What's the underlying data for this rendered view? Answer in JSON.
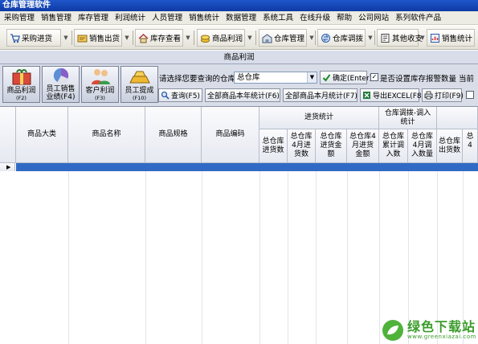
{
  "window": {
    "title": "仓库管理软件"
  },
  "menu": [
    "采购管理",
    "销售管理",
    "库存管理",
    "利润统计",
    "人员管理",
    "销售统计",
    "数据管理",
    "系统工具",
    "在线升级",
    "帮助",
    "公司网站",
    "系列软件产品"
  ],
  "toolbar": {
    "purchase": "采购进货",
    "sales": "销售出货",
    "stock": "库存查看",
    "profit": "商品利润",
    "warehouse": "仓库管理",
    "transfer": "仓库调拨",
    "other": "其他收支",
    "stats": "销售统计"
  },
  "section_title": "商品利润",
  "big_buttons": [
    {
      "label": "商品利润",
      "key": "(F2)"
    },
    {
      "label1": "员工销售",
      "label2": "业绩(F4)"
    },
    {
      "label": "客户利润",
      "key": "(F3)"
    },
    {
      "label": "员工提成",
      "key": "(F10)"
    }
  ],
  "filter": {
    "prompt": "请选择您要查询的仓库",
    "warehouse": "总仓库",
    "confirm": "确定(Enter)",
    "alarm_check": "是否设置库存报警数量",
    "alarm_checked": "✓",
    "current": "当前"
  },
  "actions": {
    "query": "查询(F5)",
    "year": "全部商品本年统计(F6)",
    "month": "全部商品本月统计(F7)",
    "excel": "导出EXCEL(F8)",
    "print": "打印(F9)"
  },
  "grid": {
    "cols": {
      "category": "商品大类",
      "name": "商品名称",
      "spec": "商品规格",
      "code": "商品编码"
    },
    "group_purchase": "进货统计",
    "group_transfer1": "仓库调拨-调入",
    "group_transfer2": "统计",
    "sub": [
      {
        "a": "总仓库",
        "b": "进货数",
        "c": ""
      },
      {
        "a": "总仓库",
        "b": "4月进",
        "c": "货数"
      },
      {
        "a": "总仓库",
        "b": "进货金",
        "c": "额"
      },
      {
        "a": "总仓库4",
        "b": "月进货",
        "c": "金额"
      },
      {
        "a": "总仓库",
        "b": "累计调",
        "c": "入数"
      },
      {
        "a": "总仓库",
        "b": "4月调",
        "c": "入数量"
      },
      {
        "a": "总仓库",
        "b": "出货数",
        "c": ""
      },
      {
        "a": "总",
        "b": "4",
        "c": ""
      }
    ],
    "row_marker": "▶"
  },
  "watermark": {
    "text": "绿色下载站",
    "url": "www.greenxiazai.com"
  },
  "colors": {
    "titlebar": "#1f56c9",
    "selected_row": "#316ac5",
    "panel": "#d9dde8"
  }
}
